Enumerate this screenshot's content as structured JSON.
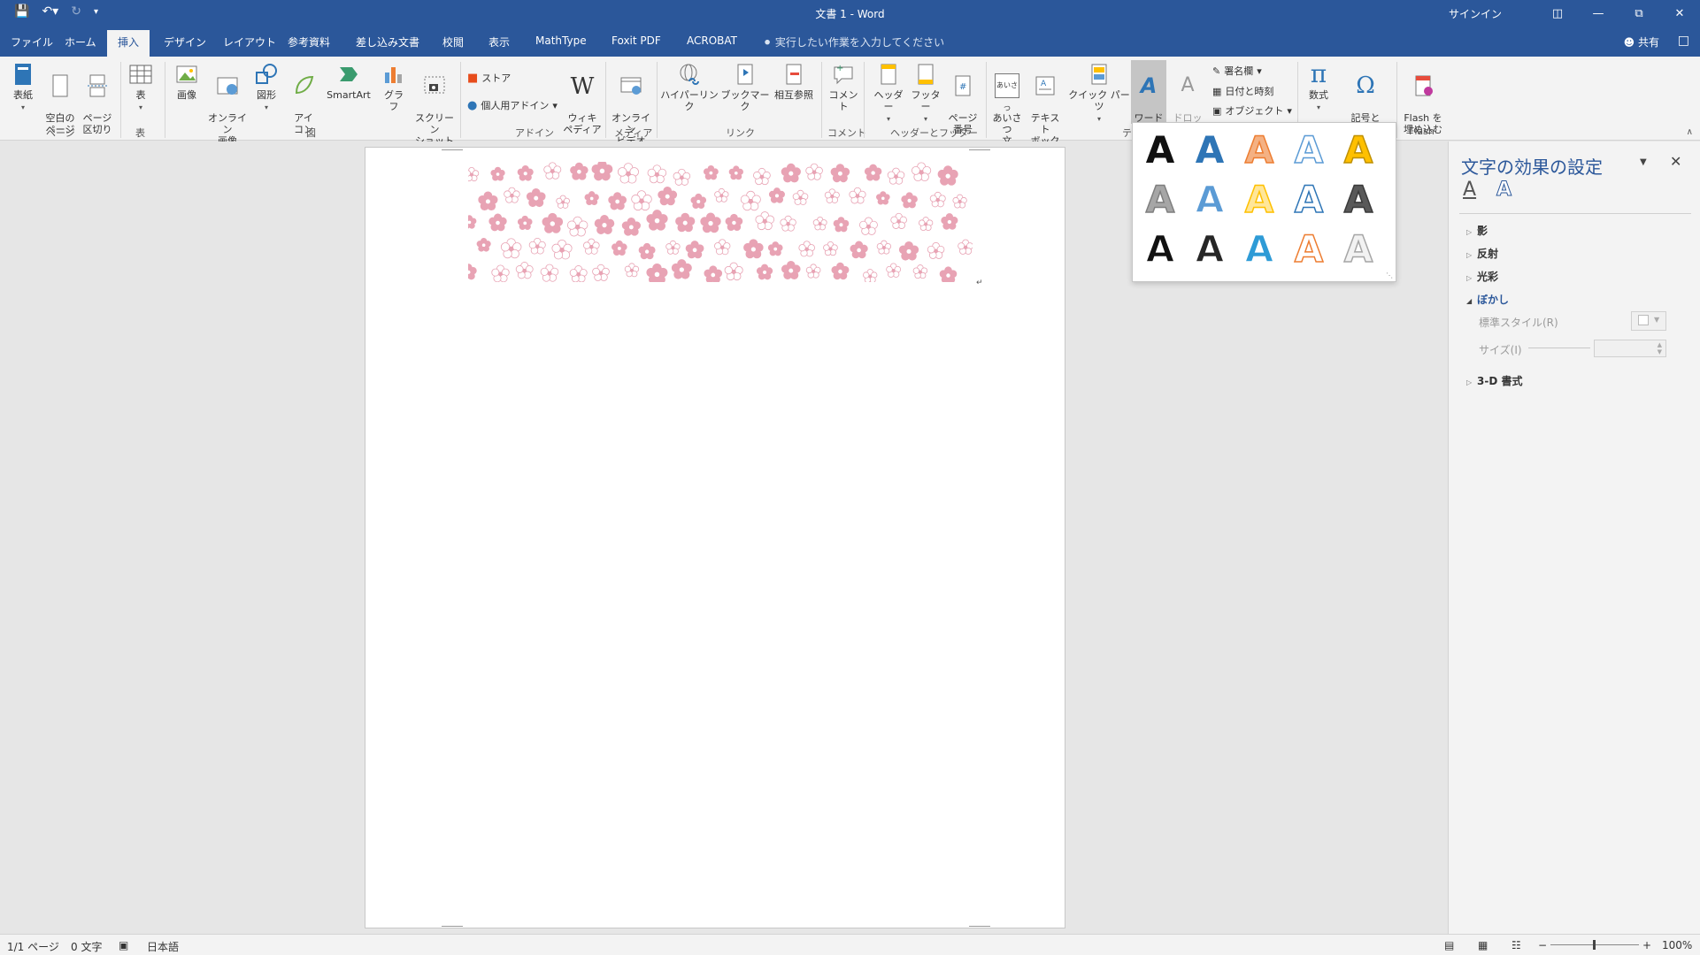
{
  "window": {
    "title": "文書 1 - Word",
    "signin": "サインイン",
    "share": "共有"
  },
  "tabs": [
    "ファイル",
    "ホーム",
    "挿入",
    "デザイン",
    "レイアウト",
    "参考資料",
    "差し込み文書",
    "校閲",
    "表示",
    "MathType",
    "Foxit PDF",
    "ACROBAT"
  ],
  "active_tab": "挿入",
  "tell_me": "実行したい作業を入力してください",
  "ribbon": {
    "pages": {
      "cover": "表紙",
      "blank": "空白の\nページ",
      "break": "ページ\n区切り",
      "group": "ページ"
    },
    "tables": {
      "table": "表",
      "group": "表"
    },
    "illustrations": {
      "picture": "画像",
      "online_picture": "オンライン\n画像",
      "shapes": "図形",
      "icons": "アイ\nコン",
      "smartart": "SmartArt",
      "chart": "グラフ",
      "screenshot": "スクリーン\nショット",
      "group": "図"
    },
    "addins": {
      "store": "ストア",
      "my_addins": "個人用アドイン",
      "wikipedia": "ウィキ\nペディア",
      "group": "アドイン"
    },
    "media": {
      "online_video": "オンライン\nビデオ",
      "group": "メディア"
    },
    "links": {
      "hyperlink": "ハイパーリンク",
      "bookmark": "ブックマーク",
      "cross_ref": "相互参照",
      "group": "リンク"
    },
    "comments": {
      "comment": "コメント",
      "group": "コメント"
    },
    "header_footer": {
      "header": "ヘッダー",
      "footer": "フッター",
      "page_number": "ページ\n番号",
      "group": "ヘッダーとフッター"
    },
    "text": {
      "greeting": "あいさつ\n文",
      "textbox": "テキスト\nボックス",
      "quick_parts": "クイック パーツ",
      "wordart": "ワード\nアート",
      "dropcap": "ドロップ\nキャップ",
      "signature": "署名欄",
      "datetime": "日付と時刻",
      "object": "オブジェクト",
      "group_partial": "テ"
    },
    "symbols": {
      "equation": "数式",
      "symbol": "記号と\n特殊文字"
    },
    "flash": {
      "embed": "Flash を\n埋め込む",
      "group": "Flash"
    },
    "greeting_icon_text": "あいさつ"
  },
  "wordart_styles": [
    {
      "fill": "#111111",
      "stroke": "none"
    },
    {
      "fill": "#2e75b6",
      "stroke": "none"
    },
    {
      "fill": "#f4b183",
      "stroke": "#ed7d31"
    },
    {
      "fill": "#ffffff",
      "stroke": "#5b9bd5"
    },
    {
      "fill": "#ffc000",
      "stroke": "#bf9000"
    },
    {
      "fill": "#a6a6a6",
      "stroke": "#7f7f7f"
    },
    {
      "fill": "#5b9bd5",
      "stroke": "#ffffff"
    },
    {
      "fill": "#ffe699",
      "stroke": "#ffc000"
    },
    {
      "fill": "#ffffff",
      "stroke": "#2e75b6"
    },
    {
      "fill": "#595959",
      "stroke": "#3a3a3a"
    },
    {
      "fill": "#111111",
      "stroke": "#ffffff"
    },
    {
      "fill": "#262626",
      "stroke": "#ffffff"
    },
    {
      "fill": "#2e9bd6",
      "stroke": "#ffffff"
    },
    {
      "fill": "#ffffff",
      "stroke": "#ed7d31"
    },
    {
      "fill": "#f2f2f2",
      "stroke": "#a6a6a6"
    }
  ],
  "pane": {
    "title": "文字の効果の設定",
    "sections": [
      "影",
      "反射",
      "光彩",
      "ぼかし",
      "3-D 書式"
    ],
    "open_section": "ぼかし",
    "preset_label": "標準スタイル(R)",
    "size_label": "サイズ(I)"
  },
  "status": {
    "page": "1/1 ページ",
    "words": "0 文字",
    "language": "日本語",
    "zoom": "100%"
  },
  "colors": {
    "accent": "#2b579a",
    "sakura": "#e8a3b4"
  }
}
